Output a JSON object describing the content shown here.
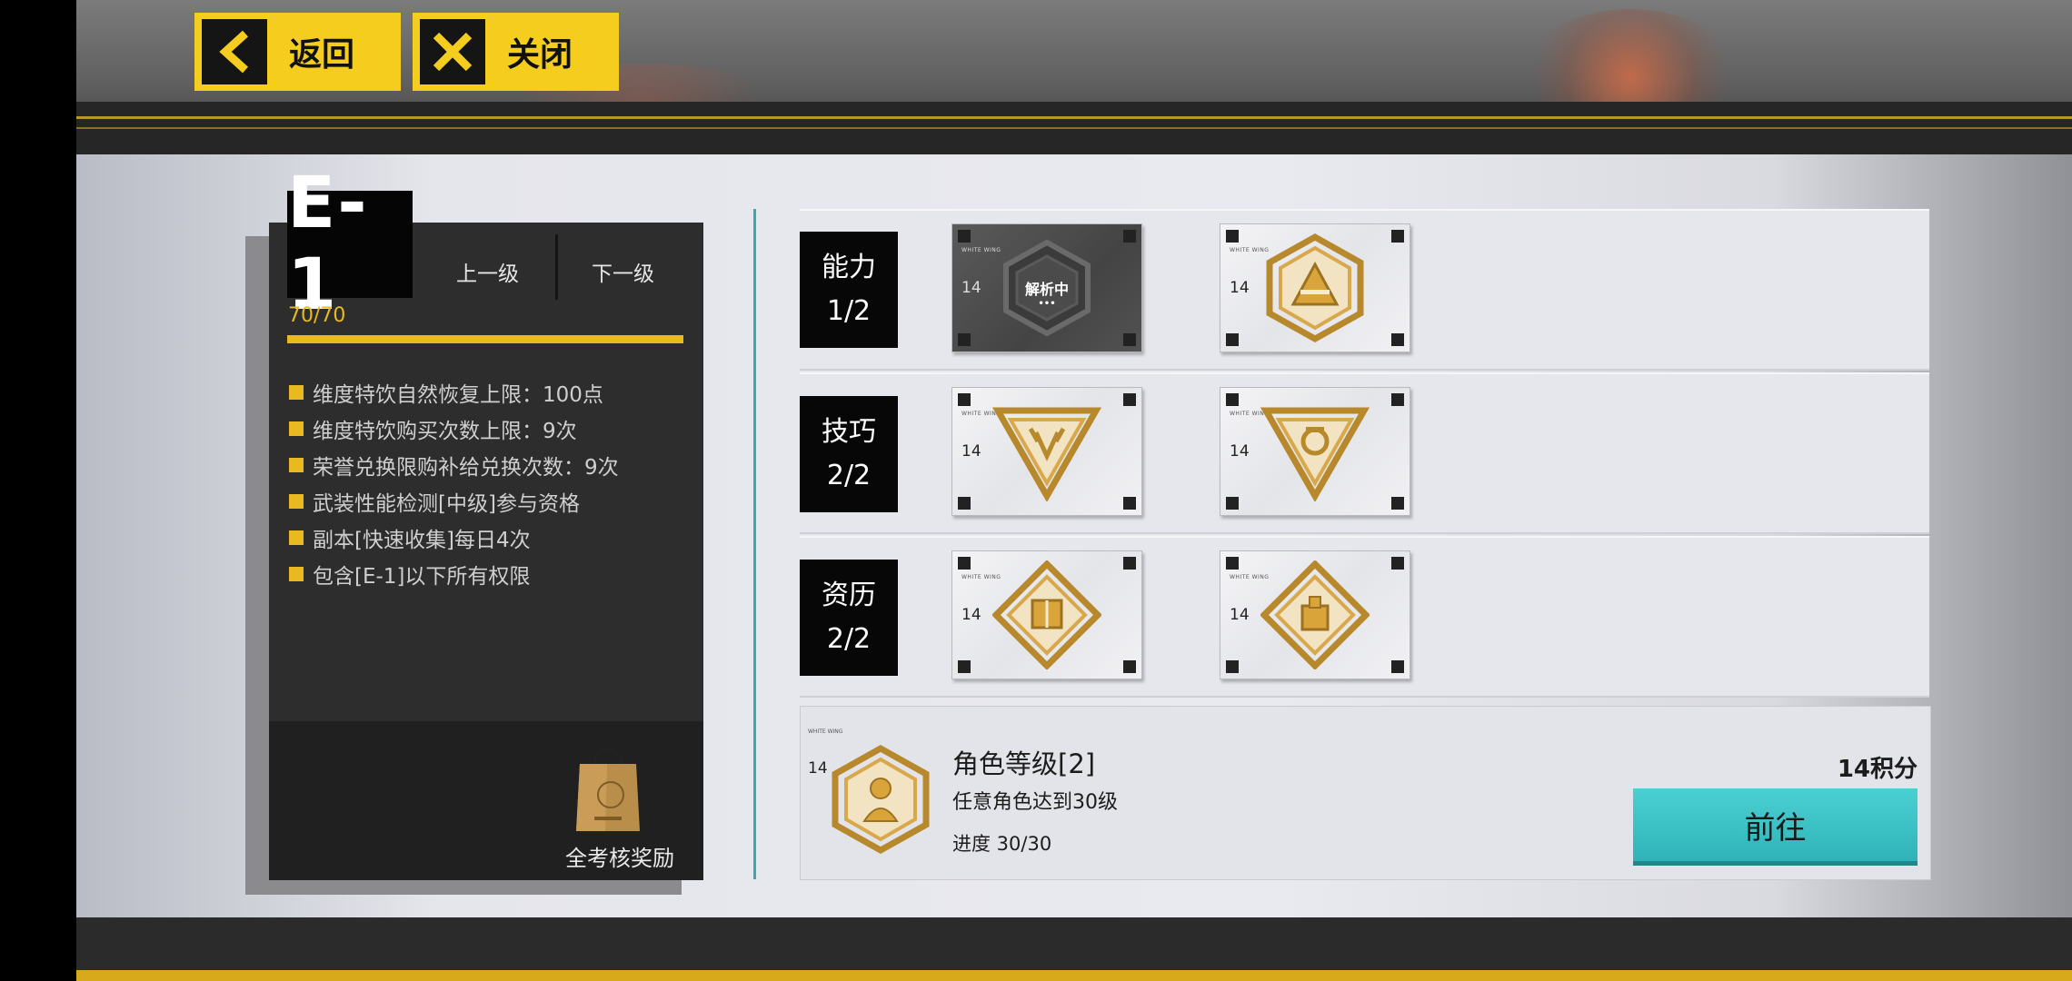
{
  "nav": {
    "back_label": "返回",
    "close_label": "关闭"
  },
  "level": {
    "grade": "E-1",
    "prev_label": "上一级",
    "next_label": "下一级",
    "progress_text": "70/70",
    "progress_fraction": 1.0,
    "perks": [
      "维度特饮自然恢复上限：100点",
      "维度特饮购买次数上限：9次",
      "荣誉兑换限购补给兑换次数：9次",
      "武装性能检测[中级]参与资格",
      "副本[快速收集]每日4次",
      "包含[E-1]以下所有权限"
    ],
    "reward_label": "全考核奖励"
  },
  "categories": [
    {
      "name": "能力",
      "count": "1/2",
      "cards": [
        {
          "number": "14",
          "tag": "WHITE WING",
          "status": "解析中",
          "status_dots": "•••",
          "icon": "locked-hexagon-medal-icon"
        },
        {
          "number": "14",
          "tag": "WHITE WING",
          "icon": "hexagon-triangle-medal-icon"
        }
      ]
    },
    {
      "name": "技巧",
      "count": "2/2",
      "cards": [
        {
          "number": "14",
          "tag": "WHITE WING",
          "icon": "triangle-antler-medal-icon"
        },
        {
          "number": "14",
          "tag": "WHITE WING",
          "icon": "triangle-ring-medal-icon"
        }
      ]
    },
    {
      "name": "资历",
      "count": "2/2",
      "cards": [
        {
          "number": "14",
          "tag": "WHITE WING",
          "icon": "diamond-book-medal-icon"
        },
        {
          "number": "14",
          "tag": "WHITE WING",
          "icon": "diamond-box-medal-icon"
        }
      ]
    }
  ],
  "task": {
    "tag": "WHITE WING",
    "number": "14",
    "title": "角色等级[2]",
    "description": "任意角色达到30级",
    "progress": "进度 30/30",
    "points": "14积分",
    "goto_label": "前往",
    "icon": "hexagon-person-medal-icon"
  },
  "colors": {
    "accent_yellow": "#f5cd1f",
    "gold": "#e9b920",
    "teal": "#3ac0c4",
    "panel_dark": "#2d2d2d"
  }
}
